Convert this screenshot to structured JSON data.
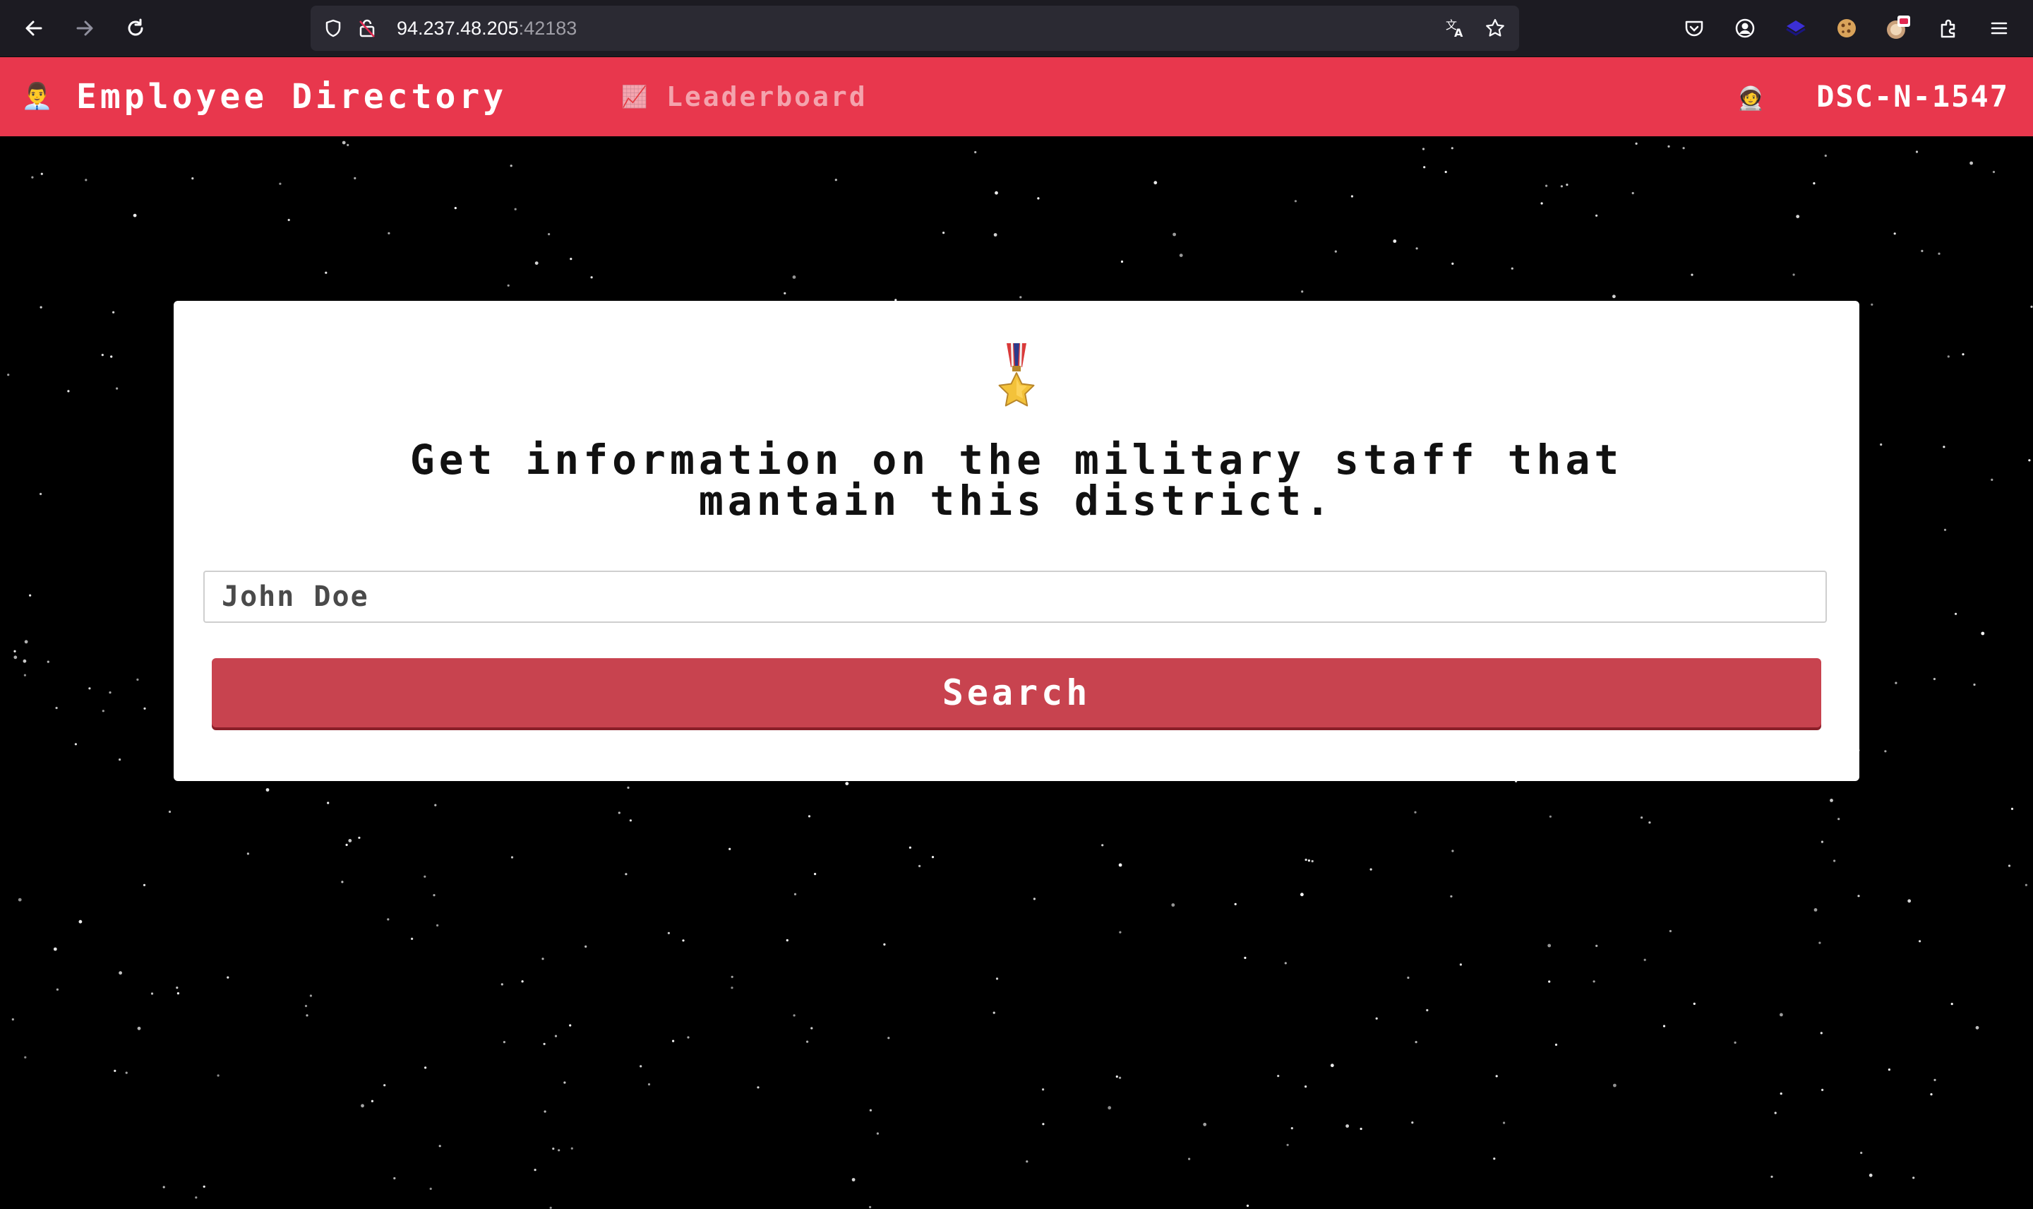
{
  "browser": {
    "url_host": "94.237.48.205",
    "url_port": ":42183"
  },
  "header": {
    "brand_emoji": "👨‍💼",
    "brand_title": "Employee Directory",
    "leaderboard_emoji": "📈",
    "leaderboard_label": "Leaderboard",
    "user_emoji": "🧑‍🚀",
    "user_id": "DSC-N-1547"
  },
  "main": {
    "medal_emoji": "🎖️",
    "headline_line1": "Get information on the military staff that",
    "headline_line2": "mantain this district.",
    "search_placeholder": "John Doe",
    "search_button_label": "Search"
  },
  "colors": {
    "header_bg": "#e8374d",
    "button_bg": "#c8434f",
    "page_bg": "#000000"
  }
}
